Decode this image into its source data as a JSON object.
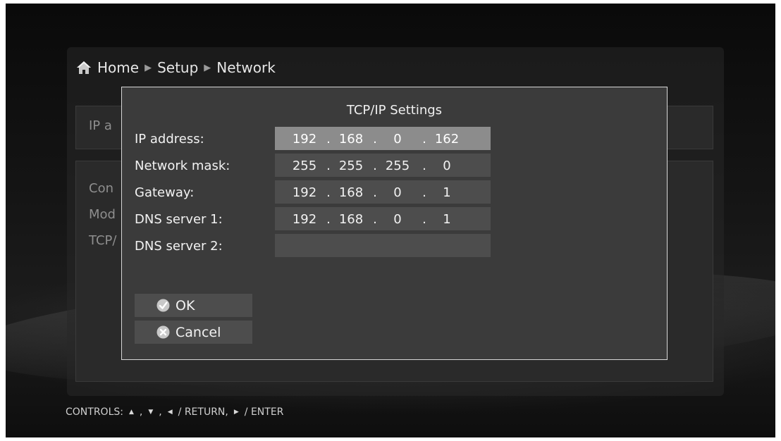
{
  "breadcrumb": {
    "items": [
      "Home",
      "Setup",
      "Network"
    ],
    "icon": "home-icon"
  },
  "background": {
    "ip_label": "IP a",
    "list_items": [
      "Con",
      "Mod",
      "TCP/"
    ]
  },
  "dialog": {
    "title": "TCP/IP Settings",
    "fields": [
      {
        "label": "IP address:",
        "octets": [
          "192",
          "168",
          "0",
          "162"
        ],
        "selected": true
      },
      {
        "label": "Network mask:",
        "octets": [
          "255",
          "255",
          "255",
          "0"
        ],
        "selected": false
      },
      {
        "label": "Gateway:",
        "octets": [
          "192",
          "168",
          "0",
          "1"
        ],
        "selected": false
      },
      {
        "label": "DNS server 1:",
        "octets": [
          "192",
          "168",
          "0",
          "1"
        ],
        "selected": false
      },
      {
        "label": "DNS server 2:",
        "octets": [],
        "selected": false
      }
    ],
    "ok_label": "OK",
    "cancel_label": "Cancel"
  },
  "controls": {
    "label": "CONTROLS:",
    "text_return": "/ RETURN,",
    "text_enter": "/ ENTER",
    "separator": ","
  },
  "colors": {
    "dialog_bg": "#3b3b3b",
    "field_bg": "#4d4d4d",
    "field_selected_bg": "#8c8c8c",
    "text": "#f2f2f2"
  }
}
